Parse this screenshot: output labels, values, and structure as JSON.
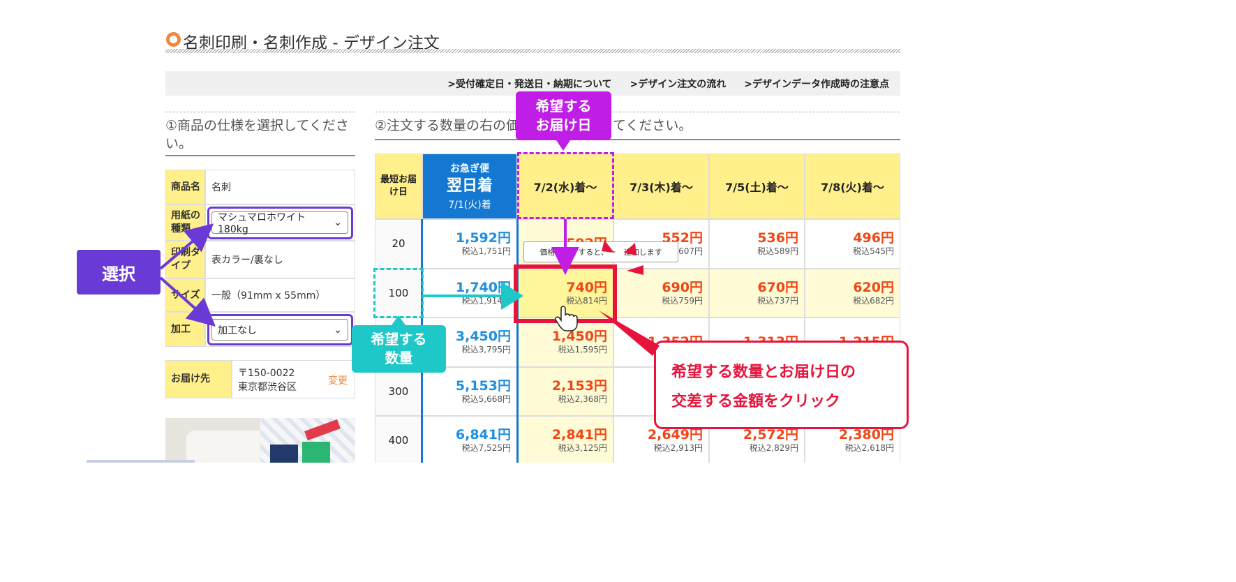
{
  "page_title": "名刺印刷・名刺作成 - デザイン注文",
  "links": [
    ">受付確定日・発送日・納期について",
    ">デザイン注文の流れ",
    ">デザインデータ作成時の注意点"
  ],
  "step1": "①商品の仕様を選択してください。",
  "step2": "②注文する数量の右の価",
  "step2_tail": "てください。",
  "spec": {
    "product_label": "商品名",
    "product_value": "名刺",
    "paper_label": "用紙の種類",
    "paper_value": "マシュマロホワイト180kg",
    "print_label": "印刷タイプ",
    "print_value": "表カラー/裏なし",
    "size_label": "サイズ",
    "size_value": "一般（91mm x 55mm）",
    "process_label": "加工",
    "process_value": "加工なし",
    "dest_label": "お届け先",
    "dest_zip": "〒150-0022",
    "dest_city": "東京都渋谷区",
    "dest_change": "変更"
  },
  "table": {
    "corner": "最短お届け日",
    "urgent_top": "お急ぎ便",
    "urgent_main": "翌日着",
    "urgent_date": "7/1(火)着",
    "dates": [
      "7/2(水)着〜",
      "7/3(木)着〜",
      "7/5(土)着〜",
      "7/8(火)着〜"
    ],
    "tax_prefix": "税込",
    "yen": "円",
    "rows": [
      {
        "qty": "20",
        "prices": [
          "1,592",
          "592",
          "552",
          "536",
          "496"
        ],
        "tax": [
          "1,751",
          "",
          "607",
          "589",
          "545"
        ]
      },
      {
        "qty": "100",
        "prices": [
          "1,740",
          "740",
          "690",
          "670",
          "620"
        ],
        "tax": [
          "1,914",
          "814",
          "759",
          "737",
          "682"
        ]
      },
      {
        "qty": "",
        "prices": [
          "3,450",
          "1,450",
          "1,352",
          "1,313",
          "1,215"
        ],
        "tax": [
          "3,795",
          "1,595",
          "",
          "",
          ""
        ]
      },
      {
        "qty": "300",
        "prices": [
          "5,153",
          "2,153",
          "",
          "",
          ""
        ],
        "tax": [
          "5,668",
          "2,368",
          "",
          "",
          ""
        ]
      },
      {
        "qty": "400",
        "prices": [
          "6,841",
          "2,841",
          "2,649",
          "2,572",
          "2,380"
        ],
        "tax": [
          "7,525",
          "3,125",
          "2,913",
          "2,829",
          "2,618"
        ]
      }
    ],
    "tooltip": "価格を　クすると、ー　追加します"
  },
  "callouts": {
    "select": "選択",
    "date": "希望する\nお届け日",
    "qty": "希望する\n数量",
    "note_line1": "希望する数量とお届け日の",
    "note_line2": "交差する金額をクリック"
  },
  "colors": {
    "accent_orange": "#f0883c",
    "header_yellow": "#fff08c",
    "urgent_blue": "#1478d2",
    "price_red": "#f04614",
    "price_blue": "#1d8fe0",
    "callout_purple": "#6a3ad6",
    "callout_magenta": "#c01ee6",
    "callout_teal": "#1ec8c8",
    "highlight_red": "#e6143c"
  }
}
